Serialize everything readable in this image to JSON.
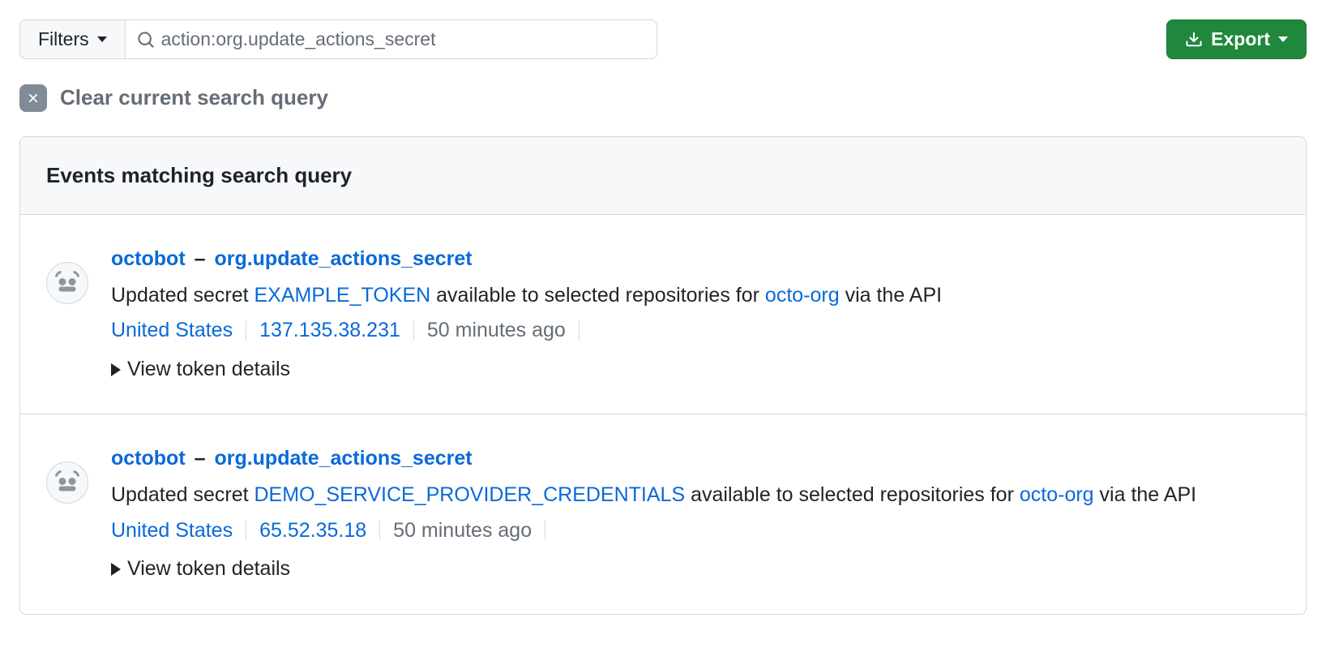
{
  "toolbar": {
    "filters_label": "Filters",
    "search_value": "action:org.update_actions_secret",
    "export_label": "Export"
  },
  "clear": {
    "label": "Clear current search query"
  },
  "results": {
    "header": "Events matching search query",
    "events": [
      {
        "actor": "octobot",
        "action": "org.update_actions_secret",
        "desc_prefix": "Updated secret ",
        "secret_name": "EXAMPLE_TOKEN",
        "desc_mid": " available to selected repositories for ",
        "org": "octo-org",
        "desc_suffix": " via the API",
        "location": "United States",
        "ip": "137.135.38.231",
        "time": "50 minutes ago",
        "details_label": "View token details"
      },
      {
        "actor": "octobot",
        "action": "org.update_actions_secret",
        "desc_prefix": "Updated secret ",
        "secret_name": "DEMO_SERVICE_PROVIDER_CREDENTIALS",
        "desc_mid": " available to selected repositories for ",
        "org": "octo-org",
        "desc_suffix": " via the API",
        "location": "United States",
        "ip": "65.52.35.18",
        "time": "50 minutes ago",
        "details_label": "View token details"
      }
    ]
  }
}
